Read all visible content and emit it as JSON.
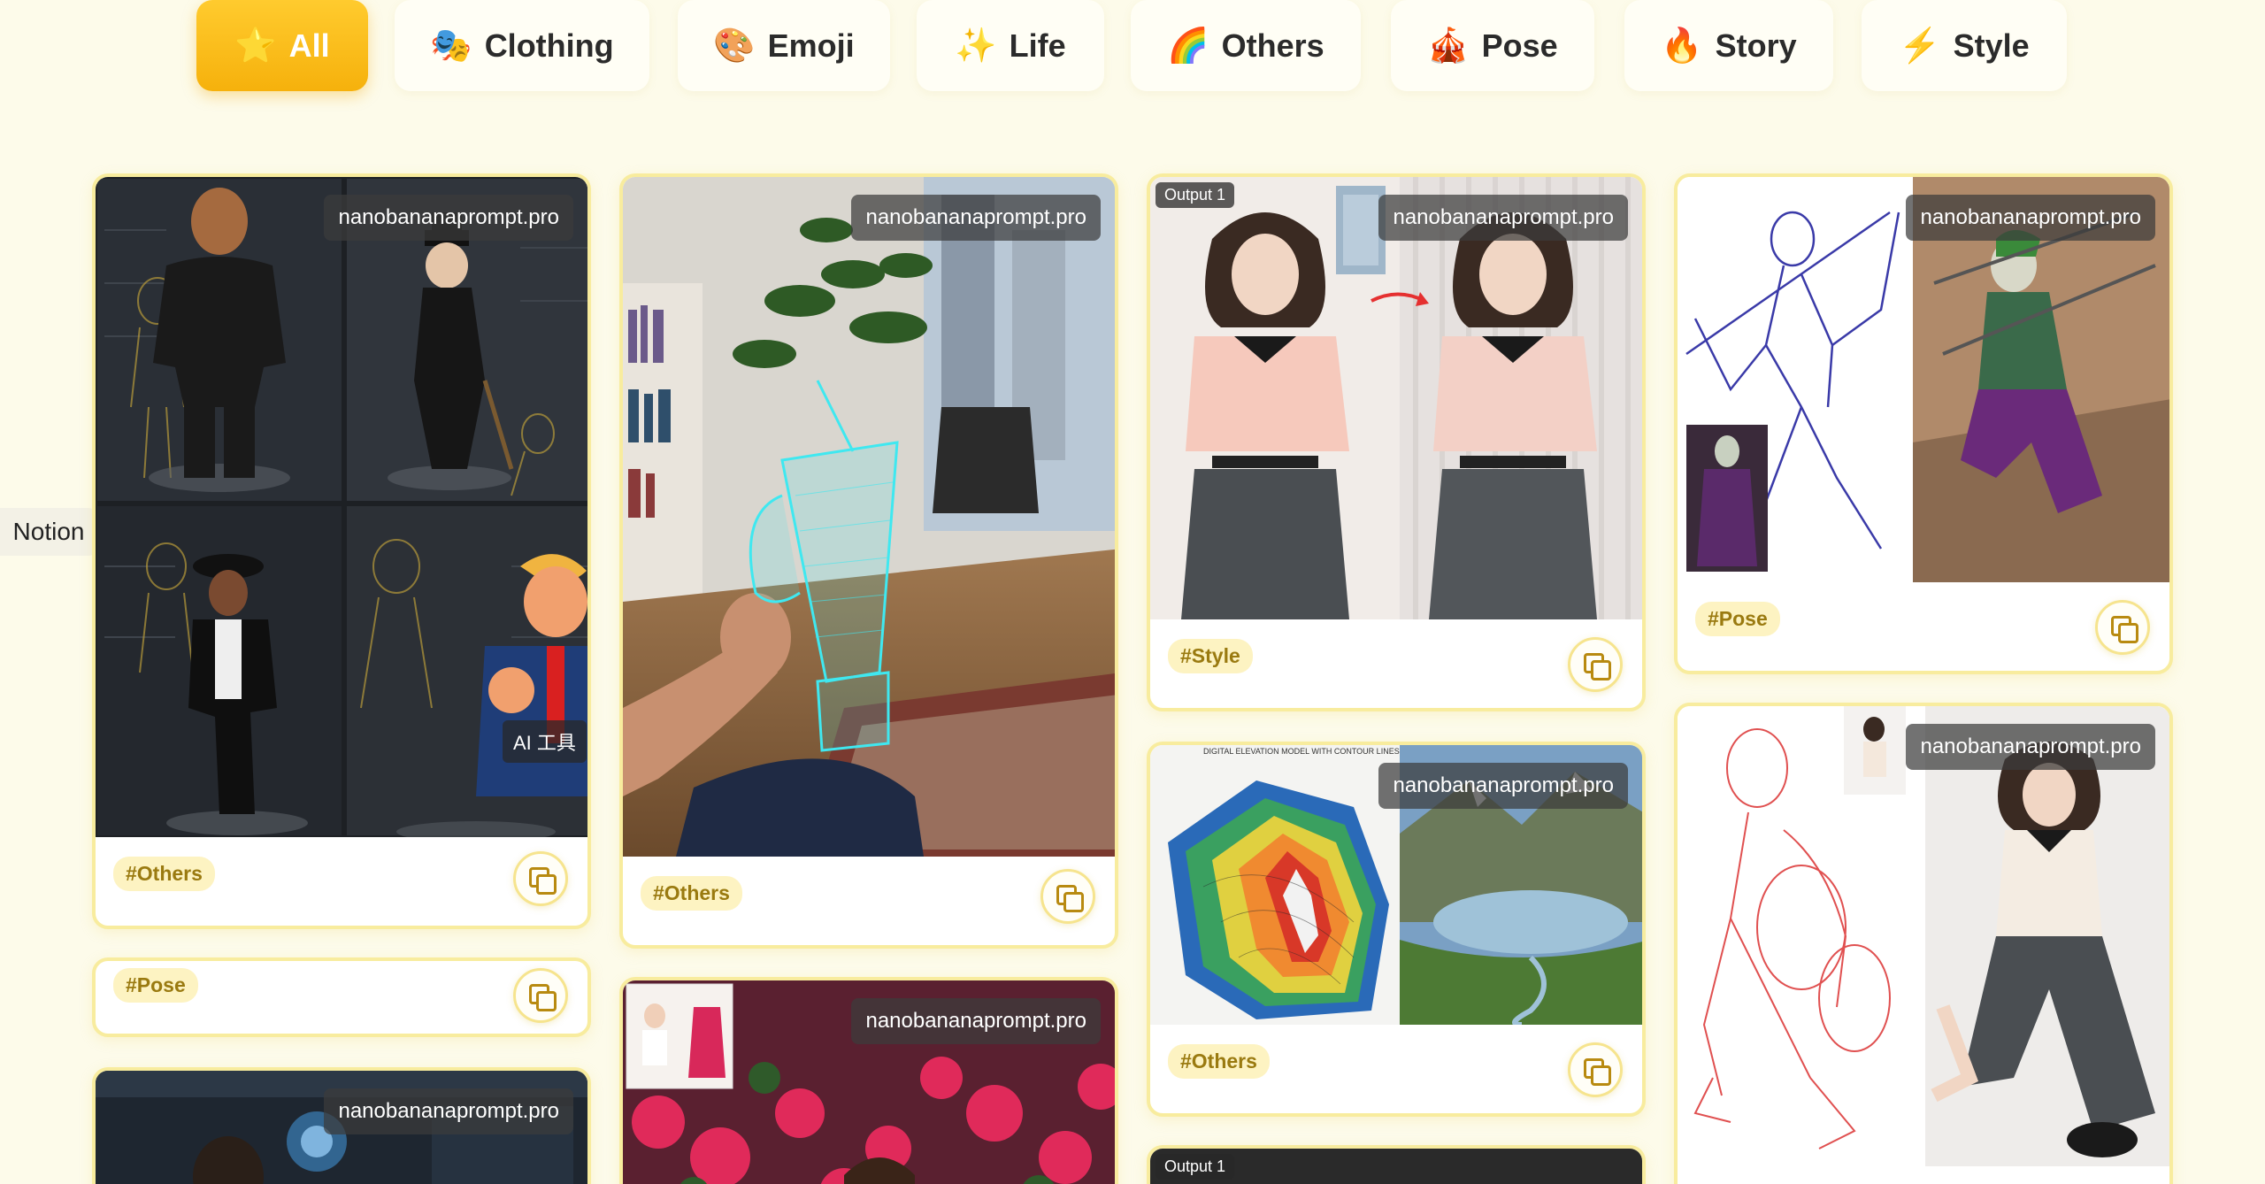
{
  "filters": [
    {
      "icon": "⭐",
      "label": "All",
      "active": true
    },
    {
      "icon": "🎭",
      "label": "Clothing",
      "active": false
    },
    {
      "icon": "🎨",
      "label": "Emoji",
      "active": false
    },
    {
      "icon": "✨",
      "label": "Life",
      "active": false
    },
    {
      "icon": "🌈",
      "label": "Others",
      "active": false
    },
    {
      "icon": "🎪",
      "label": "Pose",
      "active": false
    },
    {
      "icon": "🔥",
      "label": "Story",
      "active": false
    },
    {
      "icon": "⚡",
      "label": "Style",
      "active": false
    }
  ],
  "side_tab": {
    "label": "Notion"
  },
  "watermark": "nanobananaprompt.pro",
  "output_badge": "Output 1",
  "cards": {
    "figurines": {
      "tag": "#Others",
      "overlay_label": "AI 工具"
    },
    "pose_note": {
      "tag": "#Pose"
    },
    "cup": {
      "tag": "#Others"
    },
    "girl": {
      "tag": "#Style"
    },
    "joker": {
      "tag": "#Pose"
    },
    "terrain": {
      "tag": "#Others",
      "map_title": "DIGITAL ELEVATION MODEL WITH CONTOUR LINES"
    },
    "sketch_pose": {},
    "flowers": {},
    "robot": {},
    "bottom_output": {}
  }
}
